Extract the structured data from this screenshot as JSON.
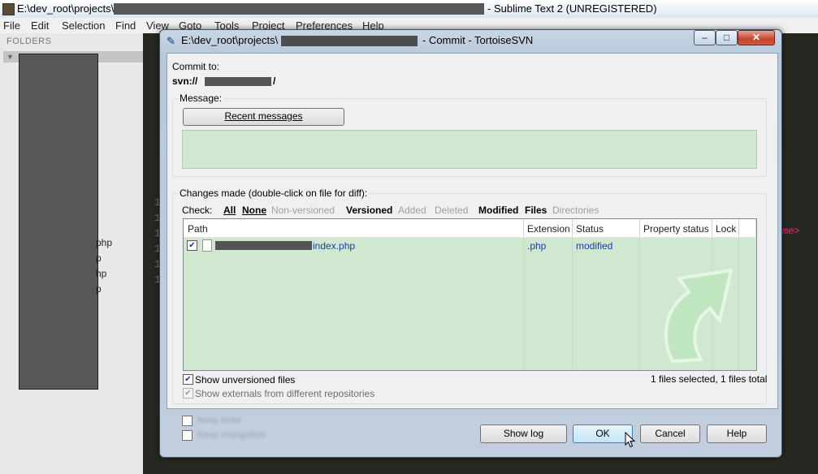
{
  "sublime": {
    "title_prefix": "E:\\dev_root\\projects\\",
    "title_suffix": "- Sublime Text 2 (UNREGISTERED)",
    "menu": [
      "File",
      "Edit",
      "Selection",
      "Find",
      "View",
      "Goto",
      "Tools",
      "Project",
      "Preferences",
      "Help"
    ],
    "sidebar_header": "FOLDERS",
    "sidebar_fragments": [
      "php",
      "p",
      "hp",
      "p"
    ],
    "line_numbers": [
      "1",
      "1",
      "1",
      "1",
      "1",
      "1"
    ],
    "editor_fragment": "me>"
  },
  "dialog": {
    "title_prefix": "E:\\dev_root\\projects\\",
    "title_suffix": "- Commit - TortoiseSVN",
    "window_buttons": {
      "minimize": "–",
      "maximize": "□",
      "close": "✕"
    },
    "commit_to_label": "Commit to:",
    "commit_url_prefix": "svn://",
    "commit_url_suffix": "/",
    "message_label": "Message:",
    "recent_messages_button": "Recent messages",
    "changes_label": "Changes made (double-click on file for diff):",
    "check_label": "Check:",
    "check_filters": [
      {
        "label": "All",
        "enabled": true,
        "underline": true
      },
      {
        "label": "None",
        "enabled": true,
        "underline": true
      },
      {
        "label": "Non-versioned",
        "enabled": false
      },
      {
        "label": "Versioned",
        "enabled": true
      },
      {
        "label": "Added",
        "enabled": false
      },
      {
        "label": "Deleted",
        "enabled": false
      },
      {
        "label": "Modified",
        "enabled": true
      },
      {
        "label": "Files",
        "enabled": true
      },
      {
        "label": "Directories",
        "enabled": false
      }
    ],
    "columns": [
      "Path",
      "Extension",
      "Status",
      "Property status",
      "Lock"
    ],
    "rows": [
      {
        "checked": true,
        "path": "index.php",
        "extension": ".php",
        "status": "modified",
        "property_status": "",
        "lock": ""
      }
    ],
    "show_unversioned_label": "Show unversioned files",
    "show_unversioned_checked": true,
    "show_externals_label": "Show externals from different repositories",
    "show_externals_checked": true,
    "show_externals_enabled": false,
    "selection_summary": "1 files selected, 1 files total",
    "blurred_options": [
      "Keep locks",
      "Keep changelists"
    ],
    "buttons": {
      "show_log": "Show log",
      "ok": "OK",
      "cancel": "Cancel",
      "help": "Help"
    }
  },
  "colors": {
    "list_bg": "#cfe8cf",
    "link_blue": "#1a3f9a",
    "dialog_frame": "#c2cedd"
  }
}
